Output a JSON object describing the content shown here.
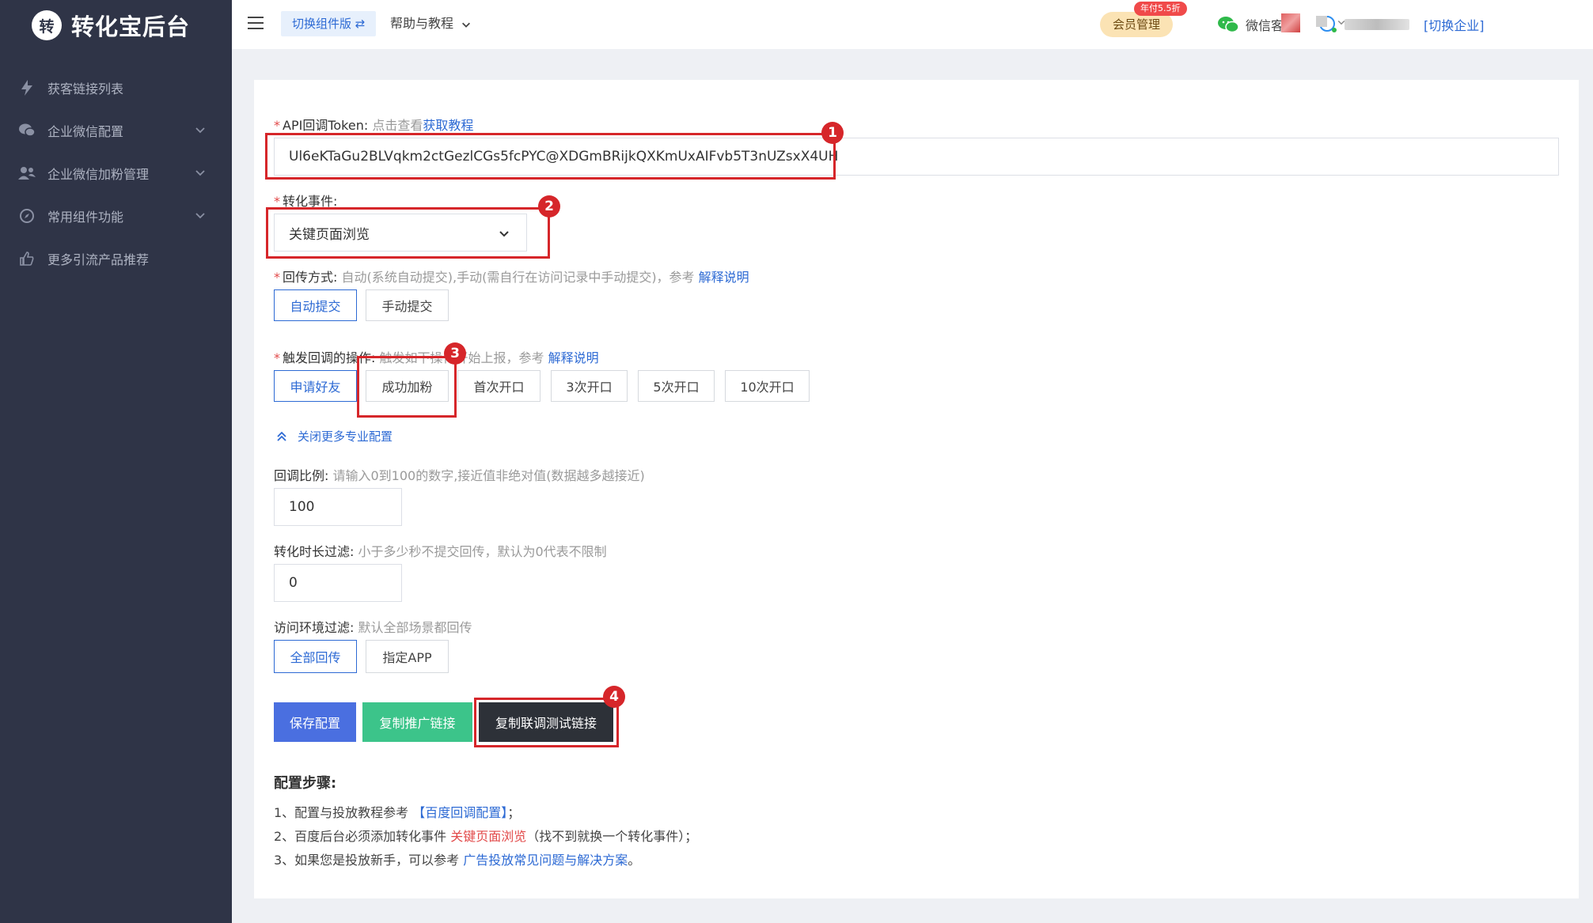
{
  "sidebar": {
    "logo_char": "转",
    "logo_text": "转化宝后台",
    "items": [
      {
        "label": "获客链接列表"
      },
      {
        "label": "企业微信配置"
      },
      {
        "label": "企业微信加粉管理"
      },
      {
        "label": "常用组件功能"
      },
      {
        "label": "更多引流产品推荐"
      }
    ]
  },
  "topbar": {
    "switch_label": "切换组件版 ⇄",
    "help_label": "帮助与教程",
    "member_label": "会员管理",
    "member_badge": "年付5.5折",
    "wechat_service": "微信客服",
    "switch_company": "[切换企业]"
  },
  "form": {
    "token_label": "API回调Token:",
    "token_hint": "点击查看",
    "token_link": "获取教程",
    "token_value": "Ul6eKTaGu2BLVqkm2ctGezlCGs5fcPYC@XDGmBRijkQXKmUxAIFvb5T3nUZsxX4UH",
    "event_label": "转化事件:",
    "event_value": "关键页面浏览",
    "return_label": "回传方式:",
    "return_hint": "自动(系统自动提交),手动(需自行在访问记录中手动提交)，参考",
    "return_link": "解释说明",
    "return_options": [
      "自动提交",
      "手动提交"
    ],
    "trigger_label": "触发回调的操作:",
    "trigger_hint": "触发如下操作开始上报，参考",
    "trigger_link": "解释说明",
    "trigger_options": [
      "申请好友",
      "成功加粉",
      "首次开口",
      "3次开口",
      "5次开口",
      "10次开口"
    ],
    "collapse_label": "关闭更多专业配置",
    "ratio_label": "回调比例:",
    "ratio_hint": "请输入0到100的数字,接近值非绝对值(数据越多越接近)",
    "ratio_value": "100",
    "duration_label": "转化时长过滤:",
    "duration_hint": "小于多少秒不提交回传，默认为0代表不限制",
    "duration_value": "0",
    "env_label": "访问环境过滤:",
    "env_hint": "默认全部场景都回传",
    "env_options": [
      "全部回传",
      "指定APP"
    ]
  },
  "buttons": {
    "save": "保存配置",
    "copy_promo": "复制推广链接",
    "copy_test": "复制联调测试链接"
  },
  "steps": {
    "title": "配置步骤:",
    "line1_prefix": "1、配置与投放教程参考",
    "line1_link": "【百度回调配置】",
    "line1_suffix": "；",
    "line2_prefix": "2、百度后台必须添加转化事件",
    "line2_highlight": "关键页面浏览",
    "line2_suffix": "（找不到就换一个转化事件）；",
    "line3_prefix": "3、如果您是投放新手，可以参考",
    "line3_link": "广告投放常见问题与解决方案",
    "line3_suffix": "。"
  },
  "annotations": [
    "1",
    "2",
    "3",
    "4"
  ],
  "colors": {
    "sidebar_bg": "#2f3447",
    "link": "#2d6ad4",
    "save_btn": "#4a6fe0",
    "promo_btn": "#3cc48a",
    "test_btn": "#2d3138",
    "highlight_box": "#d6262a"
  }
}
